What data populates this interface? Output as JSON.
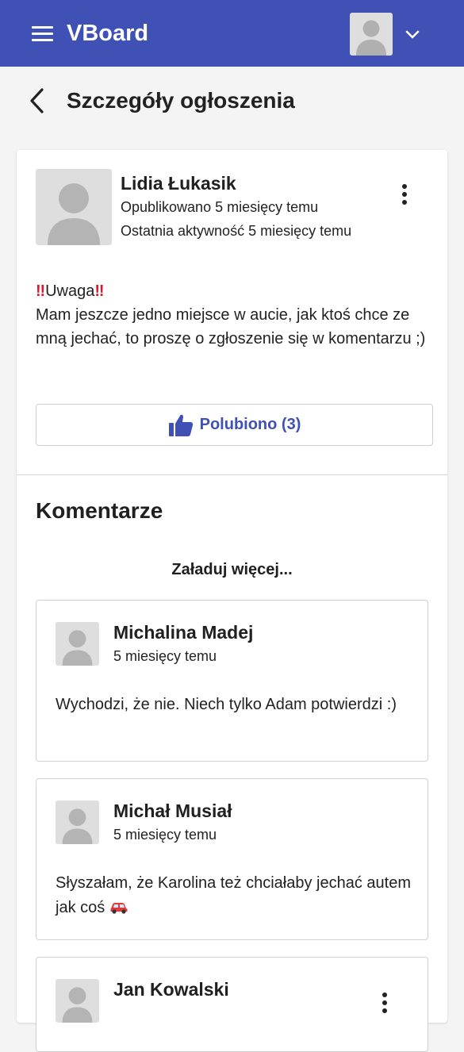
{
  "appbar": {
    "title": "VBoard",
    "menu_icon": "hamburger-menu-icon",
    "account_icon": "user-avatar-icon",
    "dropdown_icon": "chevron-down-icon",
    "color": "#3f51b5"
  },
  "subheader": {
    "title": "Szczegóły ogłoszenia",
    "back_icon": "chevron-left-icon"
  },
  "post": {
    "author": "Lidia Łukasik",
    "published": "Opublikowano 5 miesięcy temu",
    "last_activity": "Ostatnia aktywność 5 miesięcy temu",
    "body_prefix_icon": "double-exclamation-icon",
    "body_heading": "Uwaga",
    "body_suffix_icon": "double-exclamation-icon",
    "body_text": "Mam jeszcze jedno miejsce w aucie, jak ktoś chce ze mną jechać, to proszę o zgłoszenie się w komentarzu ;)",
    "like_label": "Polubiono (3)",
    "like_icon": "thumbs-up-icon"
  },
  "comments": {
    "title": "Komentarze",
    "load_more": "Załaduj więcej...",
    "items": [
      {
        "author": "Michalina Madej",
        "time": "5 miesięcy temu",
        "text": "Wychodzi, że nie. Niech tylko Adam potwierdzi :)"
      },
      {
        "author": "Michał Musiał",
        "time": "5 miesięcy temu",
        "text": "Słyszałam, że Karolina też chciałaby jechać autem jak coś",
        "trailing_icon": "red-car-icon"
      },
      {
        "author": "Jan Kowalski"
      }
    ]
  }
}
